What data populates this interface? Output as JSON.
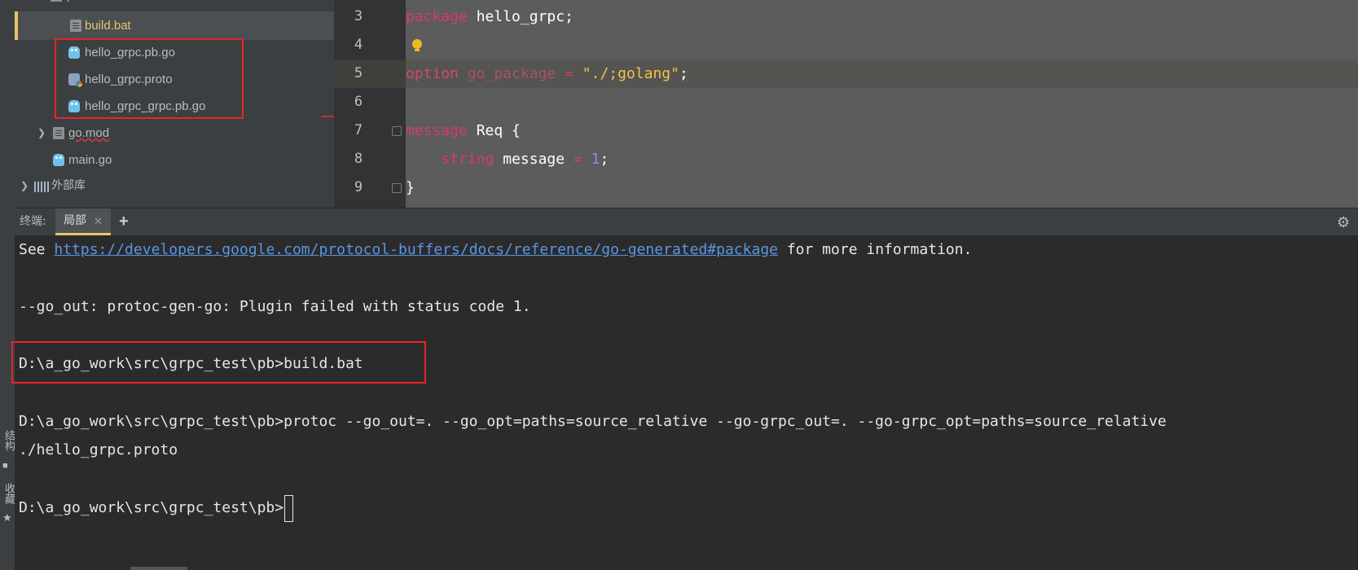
{
  "project_tree": {
    "items": [
      {
        "label": "build.bat",
        "icon": "batch-file-icon",
        "selected": true
      },
      {
        "label": "hello_grpc.pb.go",
        "icon": "go-file-icon"
      },
      {
        "label": "hello_grpc.proto",
        "icon": "proto-file-icon"
      },
      {
        "label": "hello_grpc_grpc.pb.go",
        "icon": "go-file-icon"
      },
      {
        "label": "go.mod",
        "icon": "mod-file-icon"
      },
      {
        "label": "main.go",
        "icon": "go-file-icon"
      },
      {
        "label": "外部库",
        "icon": "library-icon"
      }
    ]
  },
  "side_strip": {
    "structure": "结构",
    "favorites": "收藏"
  },
  "editor": {
    "line_numbers": [
      "3",
      "4",
      "5",
      "6",
      "7",
      "8",
      "9"
    ],
    "current_line": "5",
    "lines": {
      "l3_kw": "package",
      "l3_rest": " hello_grpc;",
      "l5_kw": "option",
      "l5_name": " go_package",
      "l5_eq": " = ",
      "l5_str": "\"./;golang\"",
      "l5_end": ";",
      "l7_kw": "message",
      "l7_rest": " Req {",
      "l8_indent": "    ",
      "l8_type": "string",
      "l8_field": " message ",
      "l8_eq": "=",
      "l8_num": " 1",
      "l8_end": ";",
      "l9": "}"
    }
  },
  "terminal": {
    "title": "终端:",
    "tab_label": "局部",
    "lines": {
      "see_prefix": "See ",
      "see_link": "https://developers.google.com/protocol-buffers/docs/reference/go-generated#package",
      "see_suffix": " for more information.",
      "go_out": "--go_out: protoc-gen-go: Plugin failed with status code 1.",
      "build_cmd": "D:\\a_go_work\\src\\grpc_test\\pb>build.bat",
      "protoc_cmd": "D:\\a_go_work\\src\\grpc_test\\pb>protoc --go_out=. --go_opt=paths=source_relative --go-grpc_out=. --go-grpc_opt=paths=source_relative",
      "protoc_cont": "./hello_grpc.proto",
      "prompt": "D:\\a_go_work\\src\\grpc_test\\pb>"
    }
  },
  "colors": {
    "keyword": "#d63a6e",
    "string": "#f5c14d",
    "number": "#a580e6",
    "link": "#5897e4",
    "highlight_box": "#e5252a",
    "selection_marker": "#e8c46a"
  }
}
